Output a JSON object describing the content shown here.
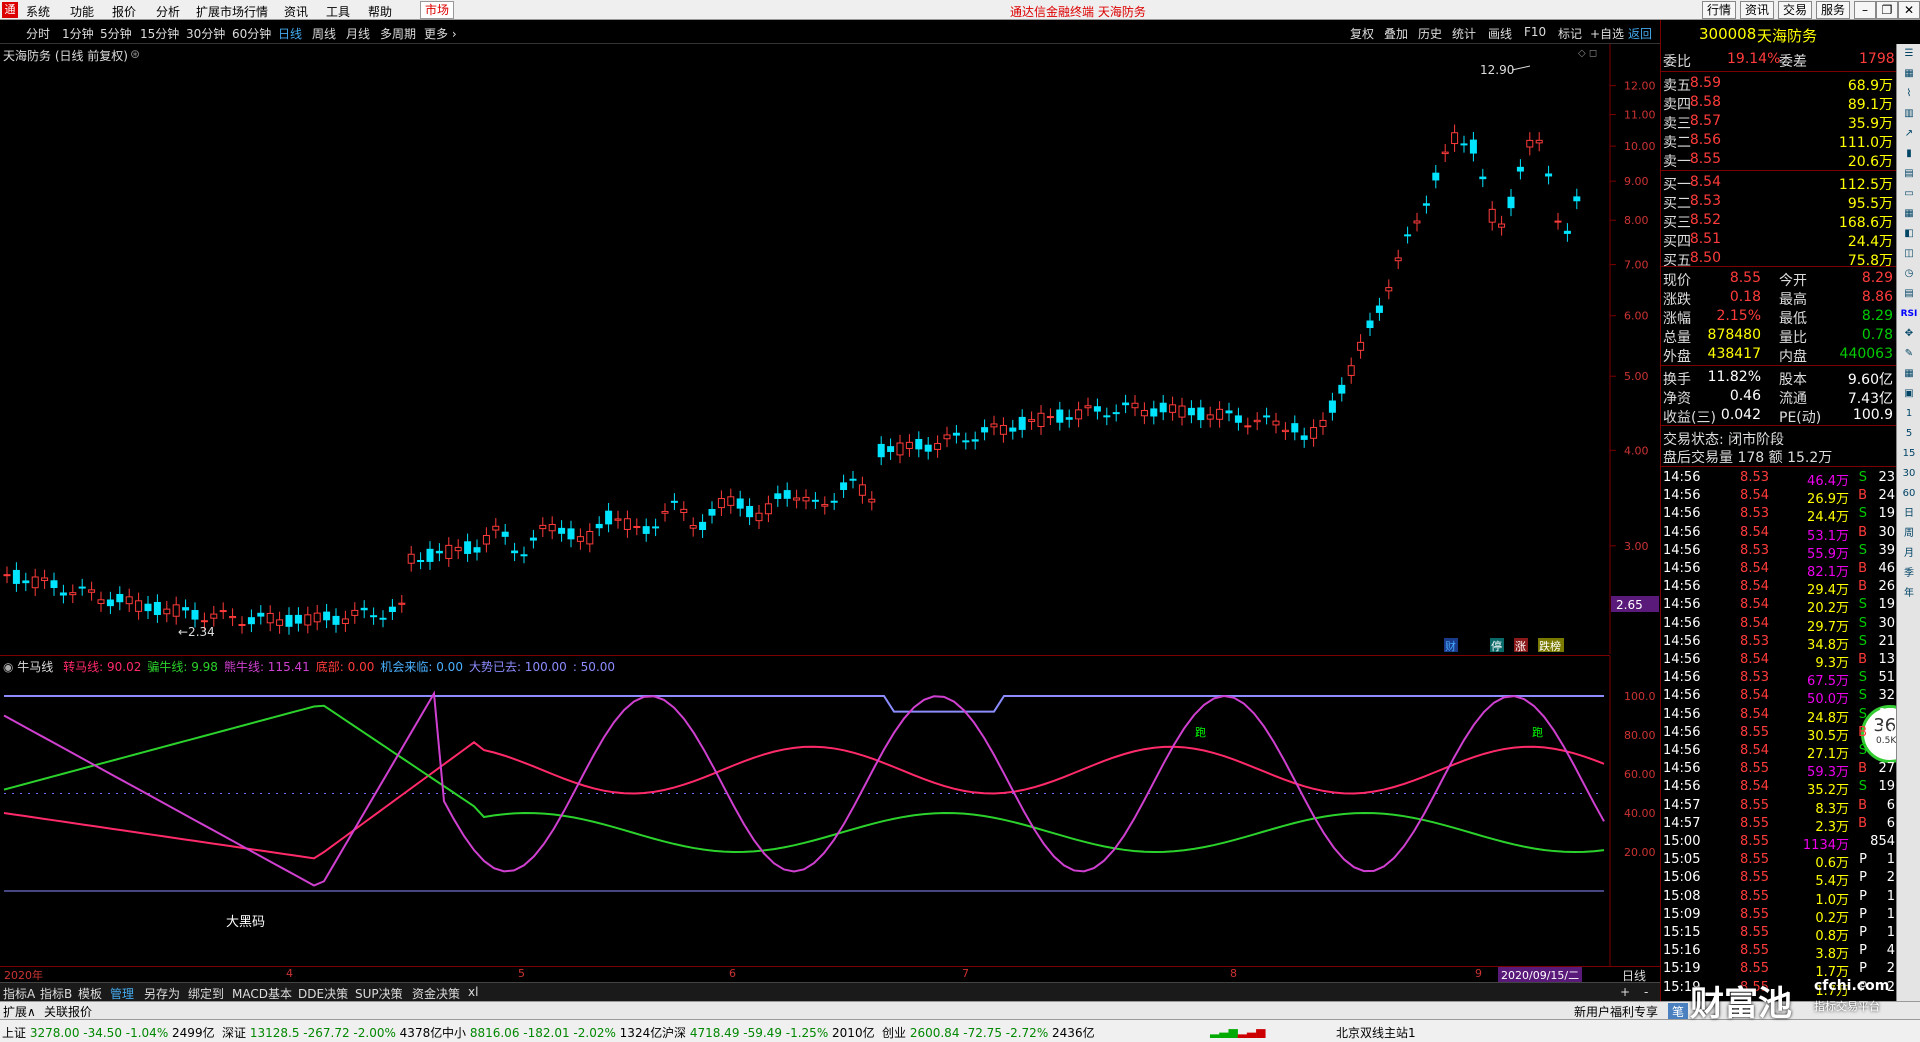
{
  "window": {
    "title": "通达信金融终端  天海防务",
    "menus": [
      "系统",
      "功能",
      "报价",
      "分析",
      "扩展市场行情",
      "资讯",
      "工具",
      "帮助"
    ],
    "market_tab": "市场",
    "right_buttons": [
      "行情",
      "资讯",
      "交易",
      "服务"
    ],
    "window_controls": [
      "minimize",
      "restore",
      "close"
    ]
  },
  "toolbar": {
    "periods": [
      "分时",
      "1分钟",
      "5分钟",
      "15分钟",
      "30分钟",
      "60分钟",
      "日线",
      "周线",
      "月线",
      "多周期",
      "更多"
    ],
    "active": "日线",
    "right": [
      "复权",
      "叠加",
      "历史",
      "统计",
      "画线",
      "F10",
      "标记",
      "+自选",
      "返回"
    ]
  },
  "chart": {
    "title": "天海防务 (日线 前复权)",
    "price_ticks": [
      "12.00",
      "11.00",
      "10.00",
      "9.00",
      "8.00",
      "7.00",
      "6.00",
      "5.00",
      "4.00",
      "3.00"
    ],
    "current_price_label": "2.65",
    "high_annot": "12.90",
    "low_annot": "2.34",
    "markers": [
      "财",
      "停",
      "涨",
      "跌榜"
    ]
  },
  "indicator": {
    "name": "牛马线",
    "legend": [
      {
        "label": "转马线:",
        "value": "90.02",
        "color": "#ff2a6a"
      },
      {
        "label": "骗牛线:",
        "value": "9.98",
        "color": "#2cd22c"
      },
      {
        "label": "熊牛线:",
        "value": "115.41",
        "color": "#d040d0"
      },
      {
        "label": "底部:",
        "value": "0.00",
        "color": "#ff3b3b"
      },
      {
        "label": "机会来临:",
        "value": "0.00",
        "color": "#4ab0ff"
      },
      {
        "label": "大势已去:",
        "value": "100.00",
        "color": "#8c8cff"
      },
      {
        "label": ":",
        "value": "50.00",
        "color": "#8c8cff"
      }
    ],
    "ticks": [
      "100.0",
      "80.00",
      "60.00",
      "40.00",
      "20.00"
    ],
    "annotation": "大黑码",
    "run_label": "跑"
  },
  "dates": {
    "labels": [
      "2020年",
      "4",
      "5",
      "6",
      "7",
      "8",
      "9"
    ],
    "current": "2020/09/15/二",
    "period": "日线"
  },
  "tabs": [
    "指标A",
    "指标B",
    "模板",
    "管理",
    "另存为",
    "绑定到",
    "MACD基本",
    "DDE决策",
    "SUP决策",
    "资金决策",
    "xl"
  ],
  "expand": [
    "扩展∧",
    "关联报价"
  ],
  "stock": {
    "code": "300008",
    "name": "天海防务",
    "webi": "委比",
    "webi_val": "19.14%",
    "weicha": "委差",
    "weicha_val": "1798"
  },
  "asks": [
    {
      "l": "卖五",
      "p": "8.59",
      "v": "68.9万"
    },
    {
      "l": "卖四",
      "p": "8.58",
      "v": "89.1万"
    },
    {
      "l": "卖三",
      "p": "8.57",
      "v": "35.9万"
    },
    {
      "l": "卖二",
      "p": "8.56",
      "v": "111.0万"
    },
    {
      "l": "卖一",
      "p": "8.55",
      "v": "20.6万"
    }
  ],
  "bids": [
    {
      "l": "买一",
      "p": "8.54",
      "v": "112.5万"
    },
    {
      "l": "买二",
      "p": "8.53",
      "v": "95.5万"
    },
    {
      "l": "买三",
      "p": "8.52",
      "v": "168.6万"
    },
    {
      "l": "买四",
      "p": "8.51",
      "v": "24.4万"
    },
    {
      "l": "买五",
      "p": "8.50",
      "v": "75.8万"
    }
  ],
  "quote": [
    {
      "a": "现价",
      "av": "8.55",
      "b": "今开",
      "bv": "8.29"
    },
    {
      "a": "涨跌",
      "av": "0.18",
      "b": "最高",
      "bv": "8.86"
    },
    {
      "a": "涨幅",
      "av": "2.15%",
      "b": "最低",
      "bv": "8.29"
    },
    {
      "a": "总量",
      "av": "878480",
      "b": "量比",
      "bv": "0.78"
    },
    {
      "a": "外盘",
      "av": "438417",
      "b": "内盘",
      "bv": "440063"
    }
  ],
  "stats": [
    {
      "a": "换手",
      "av": "11.82%",
      "b": "股本",
      "bv": "9.60亿"
    },
    {
      "a": "净资",
      "av": "0.46",
      "b": "流通",
      "bv": "7.43亿"
    },
    {
      "a": "收益(三)",
      "av": "0.042",
      "b": "PE(动)",
      "bv": "100.9"
    }
  ],
  "trade_state": "交易状态: 闭市阶段",
  "after_hours": "盘后交易量  178  额  15.2万",
  "ticks": [
    {
      "t": "14:56",
      "p": "8.53",
      "v": "46.4万",
      "d": "S",
      "n": "23"
    },
    {
      "t": "14:56",
      "p": "8.54",
      "v": "26.9万",
      "d": "B",
      "n": "24"
    },
    {
      "t": "14:56",
      "p": "8.53",
      "v": "24.4万",
      "d": "S",
      "n": "19"
    },
    {
      "t": "14:56",
      "p": "8.54",
      "v": "53.1万",
      "d": "B",
      "n": "30"
    },
    {
      "t": "14:56",
      "p": "8.53",
      "v": "55.9万",
      "d": "S",
      "n": "39"
    },
    {
      "t": "14:56",
      "p": "8.54",
      "v": "82.1万",
      "d": "B",
      "n": "46"
    },
    {
      "t": "14:56",
      "p": "8.54",
      "v": "29.4万",
      "d": "B",
      "n": "26"
    },
    {
      "t": "14:56",
      "p": "8.54",
      "v": "20.2万",
      "d": "S",
      "n": "19"
    },
    {
      "t": "14:56",
      "p": "8.54",
      "v": "29.7万",
      "d": "S",
      "n": "30"
    },
    {
      "t": "14:56",
      "p": "8.53",
      "v": "34.8万",
      "d": "S",
      "n": "21"
    },
    {
      "t": "14:56",
      "p": "8.54",
      "v": "9.3万",
      "d": "B",
      "n": "13"
    },
    {
      "t": "14:56",
      "p": "8.53",
      "v": "67.5万",
      "d": "S",
      "n": "51"
    },
    {
      "t": "14:56",
      "p": "8.54",
      "v": "50.0万",
      "d": "S",
      "n": "32"
    },
    {
      "t": "14:56",
      "p": "8.54",
      "v": "24.8万",
      "d": "S",
      "n": "17"
    },
    {
      "t": "14:56",
      "p": "8.55",
      "v": "30.5万",
      "d": "B",
      "n": "17"
    },
    {
      "t": "14:56",
      "p": "8.54",
      "v": "27.1万",
      "d": "S",
      "n": "17"
    },
    {
      "t": "14:56",
      "p": "8.55",
      "v": "59.3万",
      "d": "B",
      "n": "27"
    },
    {
      "t": "14:56",
      "p": "8.54",
      "v": "35.2万",
      "d": "S",
      "n": "19"
    },
    {
      "t": "14:57",
      "p": "8.55",
      "v": "8.3万",
      "d": "B",
      "n": "6"
    },
    {
      "t": "14:57",
      "p": "8.55",
      "v": "2.3万",
      "d": "B",
      "n": "6"
    },
    {
      "t": "15:00",
      "p": "8.55",
      "v": "1134万",
      "d": "",
      "n": "854"
    },
    {
      "t": "15:05",
      "p": "8.55",
      "v": "0.6万",
      "d": "P",
      "n": "1"
    },
    {
      "t": "15:06",
      "p": "8.55",
      "v": "5.4万",
      "d": "P",
      "n": "2"
    },
    {
      "t": "15:08",
      "p": "8.55",
      "v": "1.0万",
      "d": "P",
      "n": "1"
    },
    {
      "t": "15:09",
      "p": "8.55",
      "v": "0.2万",
      "d": "P",
      "n": "1"
    },
    {
      "t": "15:15",
      "p": "8.55",
      "v": "0.8万",
      "d": "P",
      "n": "1"
    },
    {
      "t": "15:16",
      "p": "8.55",
      "v": "3.8万",
      "d": "P",
      "n": "4"
    },
    {
      "t": "15:19",
      "p": "8.55",
      "v": "1.7万",
      "d": "P",
      "n": "2"
    },
    {
      "t": "15:19",
      "p": "8.55",
      "v": "1.7万",
      "d": "P",
      "n": "2"
    }
  ],
  "gauge": {
    "percent": "36",
    "unit": "%",
    "speed": "0.5K/s"
  },
  "sidebar_labels": [
    "日",
    "周",
    "月",
    "季",
    "年"
  ],
  "status": [
    {
      "name": "上证",
      "price": "3278.00",
      "chg": "-34.50",
      "pct": "-1.04%",
      "amt": "2499亿"
    },
    {
      "name": "深证",
      "price": "13128.5",
      "chg": "-267.72",
      "pct": "-2.00%",
      "amt": "4378亿"
    },
    {
      "name": "中小",
      "price": "8816.06",
      "chg": "-182.01",
      "pct": "-2.02%",
      "amt": "1324亿"
    },
    {
      "name": "沪深",
      "price": "4718.49",
      "chg": "-59.49",
      "pct": "-1.25%",
      "amt": "2010亿"
    },
    {
      "name": "创业",
      "price": "2600.84",
      "chg": "-72.75",
      "pct": "-2.72%",
      "amt": "2436亿"
    }
  ],
  "server": "北京双线主站1",
  "promo": "新用户福利专享",
  "watermark": "财富池",
  "watermark_url": "cfchi.com",
  "watermark_sub": "指标交易平台"
}
